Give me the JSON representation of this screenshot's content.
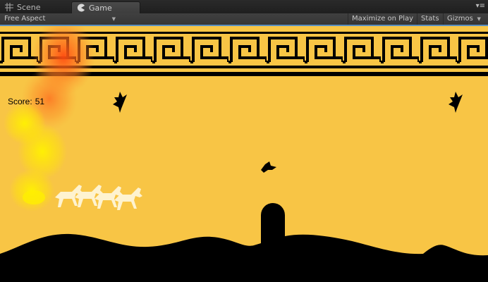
{
  "tabs": [
    {
      "label": "Scene",
      "icon": "grid-icon",
      "active": false
    },
    {
      "label": "Game",
      "icon": "pacman-icon",
      "active": true
    }
  ],
  "toolbar": {
    "aspect": "Free Aspect",
    "maximize": "Maximize on Play",
    "stats": "Stats",
    "gizmos": "Gizmos"
  },
  "game": {
    "score_label": "Score:",
    "score_value": "51",
    "background_color": "#f8c545"
  },
  "colors": {
    "accent": "#5a8fbf",
    "sky": "#f8c545",
    "silhouette": "#000000"
  }
}
